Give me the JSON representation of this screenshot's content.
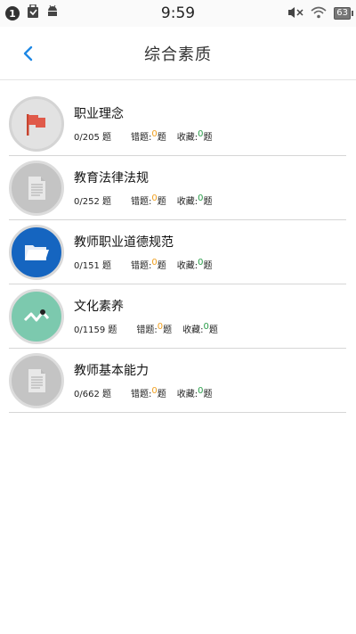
{
  "status_bar": {
    "notification_count": "1",
    "time": "9:59",
    "battery": "63"
  },
  "header": {
    "title": "综合素质"
  },
  "colors": {
    "accent": "#1e88e5",
    "wrong_highlight": "#f0a020",
    "fav_highlight": "#2a9d4a"
  },
  "items": [
    {
      "name": "职业理念",
      "progress": "0/205 题",
      "wrong_label": "错题:",
      "wrong": "0",
      "wrong_unit": "题",
      "fav_label": "收藏:",
      "fav": "0",
      "fav_unit": "题",
      "icon": "flag-icon"
    },
    {
      "name": "教育法律法规",
      "progress": "0/252 题",
      "wrong_label": "错题:",
      "wrong": "0",
      "wrong_unit": "题",
      "fav_label": "收藏:",
      "fav": "0",
      "fav_unit": "题",
      "icon": "document-icon"
    },
    {
      "name": "教师职业道德规范",
      "progress": "0/151 题",
      "wrong_label": "错题:",
      "wrong": "0",
      "wrong_unit": "题",
      "fav_label": "收藏:",
      "fav": "0",
      "fav_unit": "题",
      "icon": "folder-icon"
    },
    {
      "name": "文化素养",
      "progress": "0/1159 题",
      "wrong_label": "错题:",
      "wrong": "0",
      "wrong_unit": "题",
      "fav_label": "收藏:",
      "fav": "0",
      "fav_unit": "题",
      "icon": "line-chart-icon"
    },
    {
      "name": "教师基本能力",
      "progress": "0/662 题",
      "wrong_label": "错题:",
      "wrong": "0",
      "wrong_unit": "题",
      "fav_label": "收藏:",
      "fav": "0",
      "fav_unit": "题",
      "icon": "document-icon"
    }
  ]
}
